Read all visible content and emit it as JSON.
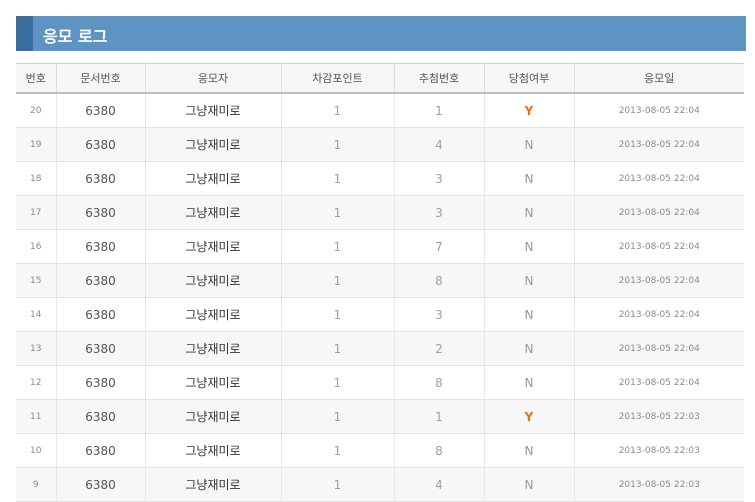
{
  "header": {
    "title": "응모 로그"
  },
  "columns": [
    "번호",
    "문서번호",
    "응모자",
    "차감포인트",
    "추첨번호",
    "당첨여부",
    "응모일"
  ],
  "rows": [
    {
      "no": "20",
      "doc": "6380",
      "user": "그냥재미로",
      "points": "1",
      "draw": "1",
      "win": "Y",
      "date": "2013-08-05 22:04"
    },
    {
      "no": "19",
      "doc": "6380",
      "user": "그냥재미로",
      "points": "1",
      "draw": "4",
      "win": "N",
      "date": "2013-08-05 22:04"
    },
    {
      "no": "18",
      "doc": "6380",
      "user": "그냥재미로",
      "points": "1",
      "draw": "3",
      "win": "N",
      "date": "2013-08-05 22:04"
    },
    {
      "no": "17",
      "doc": "6380",
      "user": "그냥재미로",
      "points": "1",
      "draw": "3",
      "win": "N",
      "date": "2013-08-05 22:04"
    },
    {
      "no": "16",
      "doc": "6380",
      "user": "그냥재미로",
      "points": "1",
      "draw": "7",
      "win": "N",
      "date": "2013-08-05 22:04"
    },
    {
      "no": "15",
      "doc": "6380",
      "user": "그냥재미로",
      "points": "1",
      "draw": "8",
      "win": "N",
      "date": "2013-08-05 22:04"
    },
    {
      "no": "14",
      "doc": "6380",
      "user": "그냥재미로",
      "points": "1",
      "draw": "3",
      "win": "N",
      "date": "2013-08-05 22:04"
    },
    {
      "no": "13",
      "doc": "6380",
      "user": "그냥재미로",
      "points": "1",
      "draw": "2",
      "win": "N",
      "date": "2013-08-05 22:04"
    },
    {
      "no": "12",
      "doc": "6380",
      "user": "그냥재미로",
      "points": "1",
      "draw": "8",
      "win": "N",
      "date": "2013-08-05 22:04"
    },
    {
      "no": "11",
      "doc": "6380",
      "user": "그냥재미로",
      "points": "1",
      "draw": "1",
      "win": "Y",
      "date": "2013-08-05 22:03"
    },
    {
      "no": "10",
      "doc": "6380",
      "user": "그냥재미로",
      "points": "1",
      "draw": "8",
      "win": "N",
      "date": "2013-08-05 22:03"
    },
    {
      "no": "9",
      "doc": "6380",
      "user": "그냥재미로",
      "points": "1",
      "draw": "4",
      "win": "N",
      "date": "2013-08-05 22:03"
    }
  ],
  "colors": {
    "header_bg": "#5f93c4",
    "header_accent": "#3a6e9f",
    "win_yes": "#e0721f"
  }
}
